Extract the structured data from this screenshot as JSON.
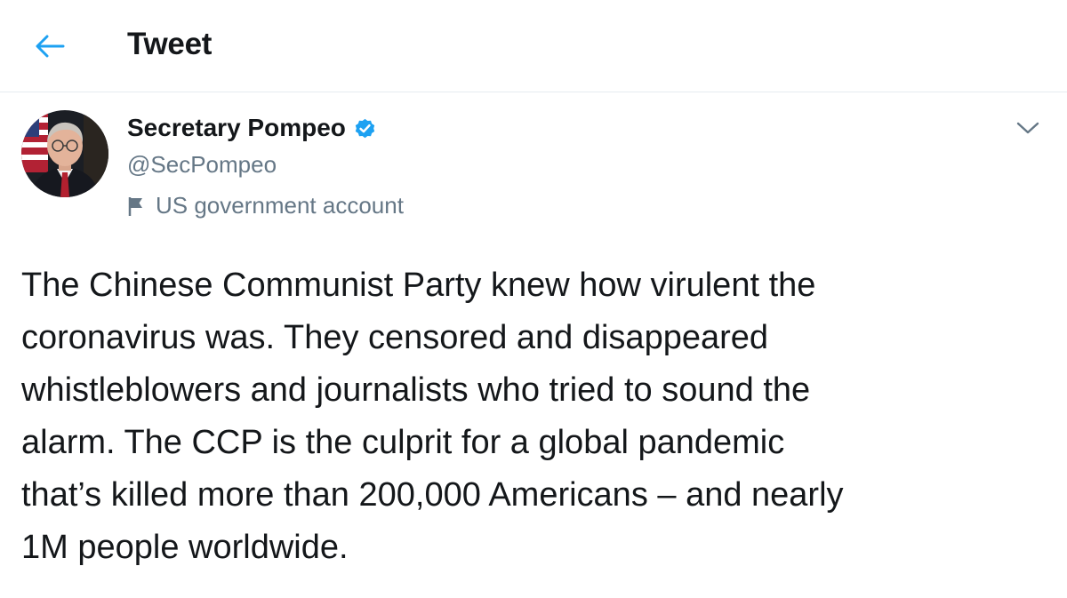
{
  "header": {
    "title": "Tweet",
    "back_icon": "arrow-left-icon",
    "accent_color": "#1da1f2"
  },
  "author": {
    "display_name": "Secretary Pompeo",
    "handle": "@SecPompeo",
    "verified_icon": "verified-badge-icon",
    "label_icon": "flag-icon",
    "label": "US government account",
    "avatar_icon": "profile-photo"
  },
  "tweet": {
    "text": "The Chinese Communist Party knew how virulent the\ncoronavirus was. They censored and disappeared\nwhistleblowers and journalists who tried to sound the\nalarm. The CCP is the culprit for a global pandemic\nthat’s killed more than 200,000 Americans – and nearly\n1M people worldwide.",
    "more_icon": "chevron-down-icon"
  },
  "colors": {
    "text_primary": "#14171a",
    "text_secondary": "#657786",
    "divider": "#e6ecf0",
    "verified": "#1da1f2"
  }
}
